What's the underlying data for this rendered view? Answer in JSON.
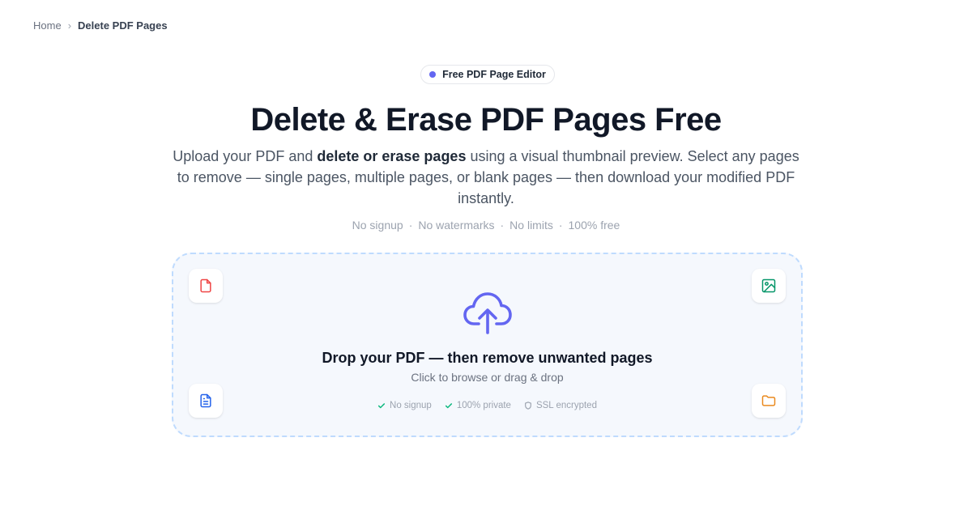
{
  "breadcrumb": {
    "home": "Home",
    "separator": "›",
    "current": "Delete PDF Pages"
  },
  "badge": {
    "label": "Free PDF Page Editor",
    "dot_color": "#6366f1"
  },
  "hero": {
    "title": "Delete & Erase PDF Pages Free",
    "subtitle_pre": "Upload your PDF and ",
    "subtitle_bold": "delete or erase pages",
    "subtitle_post": " using a visual thumbnail preview. Select any pages to remove — single pages, multiple pages, or blank pages — then download your modified PDF instantly."
  },
  "features": {
    "separator": "·",
    "items": [
      "No signup",
      "No watermarks",
      "No limits",
      "100% free"
    ]
  },
  "dropzone": {
    "title": "Drop your PDF — then remove unwanted pages",
    "subtitle": "Click to browse or drag & drop",
    "upload_icon": "cloud-upload-icon",
    "accent_color": "#6366f1",
    "trust": [
      {
        "icon": "check-icon",
        "label": "No signup"
      },
      {
        "icon": "check-icon",
        "label": "100% private"
      },
      {
        "icon": "shield-icon",
        "label": "SSL encrypted"
      }
    ],
    "corner_icons": [
      {
        "icon": "pdf-file-icon",
        "color": "#ef4444"
      },
      {
        "icon": "image-icon",
        "color": "#059669"
      },
      {
        "icon": "document-icon",
        "color": "#2563eb"
      },
      {
        "icon": "folder-icon",
        "color": "#ea8a1f"
      }
    ]
  }
}
